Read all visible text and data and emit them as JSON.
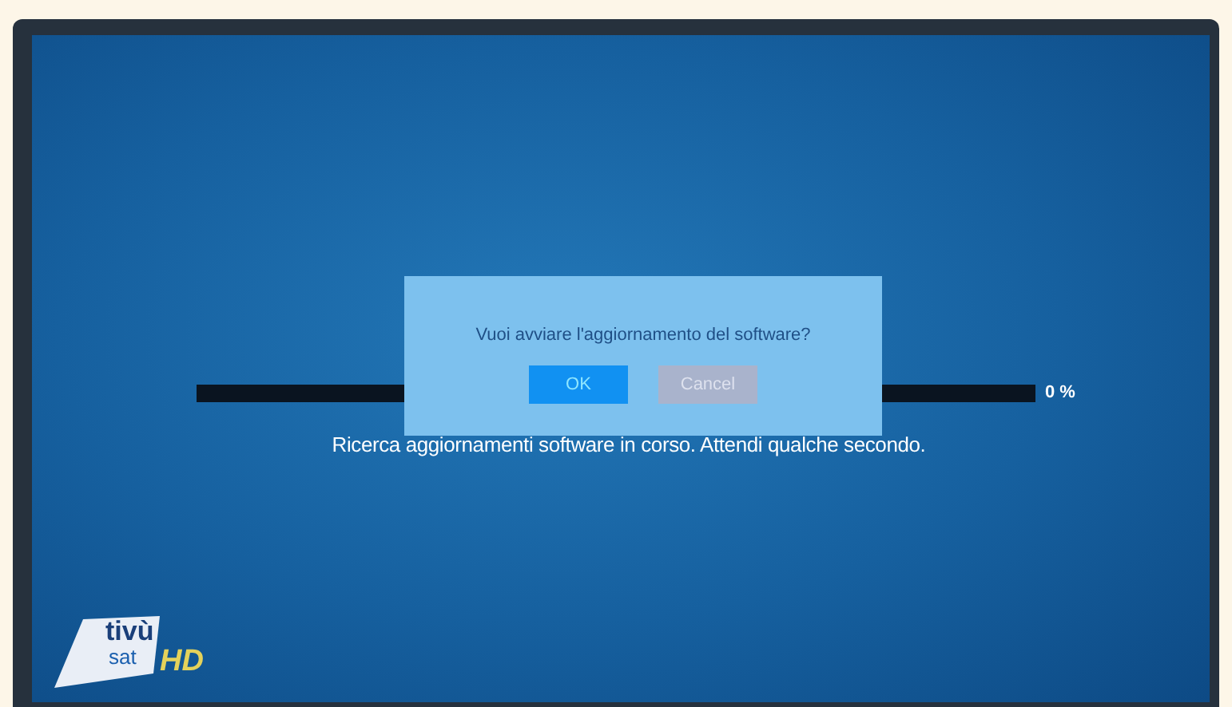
{
  "progress": {
    "level": 0,
    "reading": "0 %"
  },
  "message": "Ricerca aggiornamenti software in corso. Attendi qualche secondo.",
  "dialog": {
    "question": "Vuoi avviare l'aggiornamento del software?",
    "buttons": [
      {
        "label": "OK",
        "selected": true
      },
      {
        "label": "Cancel",
        "selected": false
      }
    ]
  },
  "logo": {
    "line1": "tivù",
    "line2": "sat",
    "badge": "HD"
  }
}
